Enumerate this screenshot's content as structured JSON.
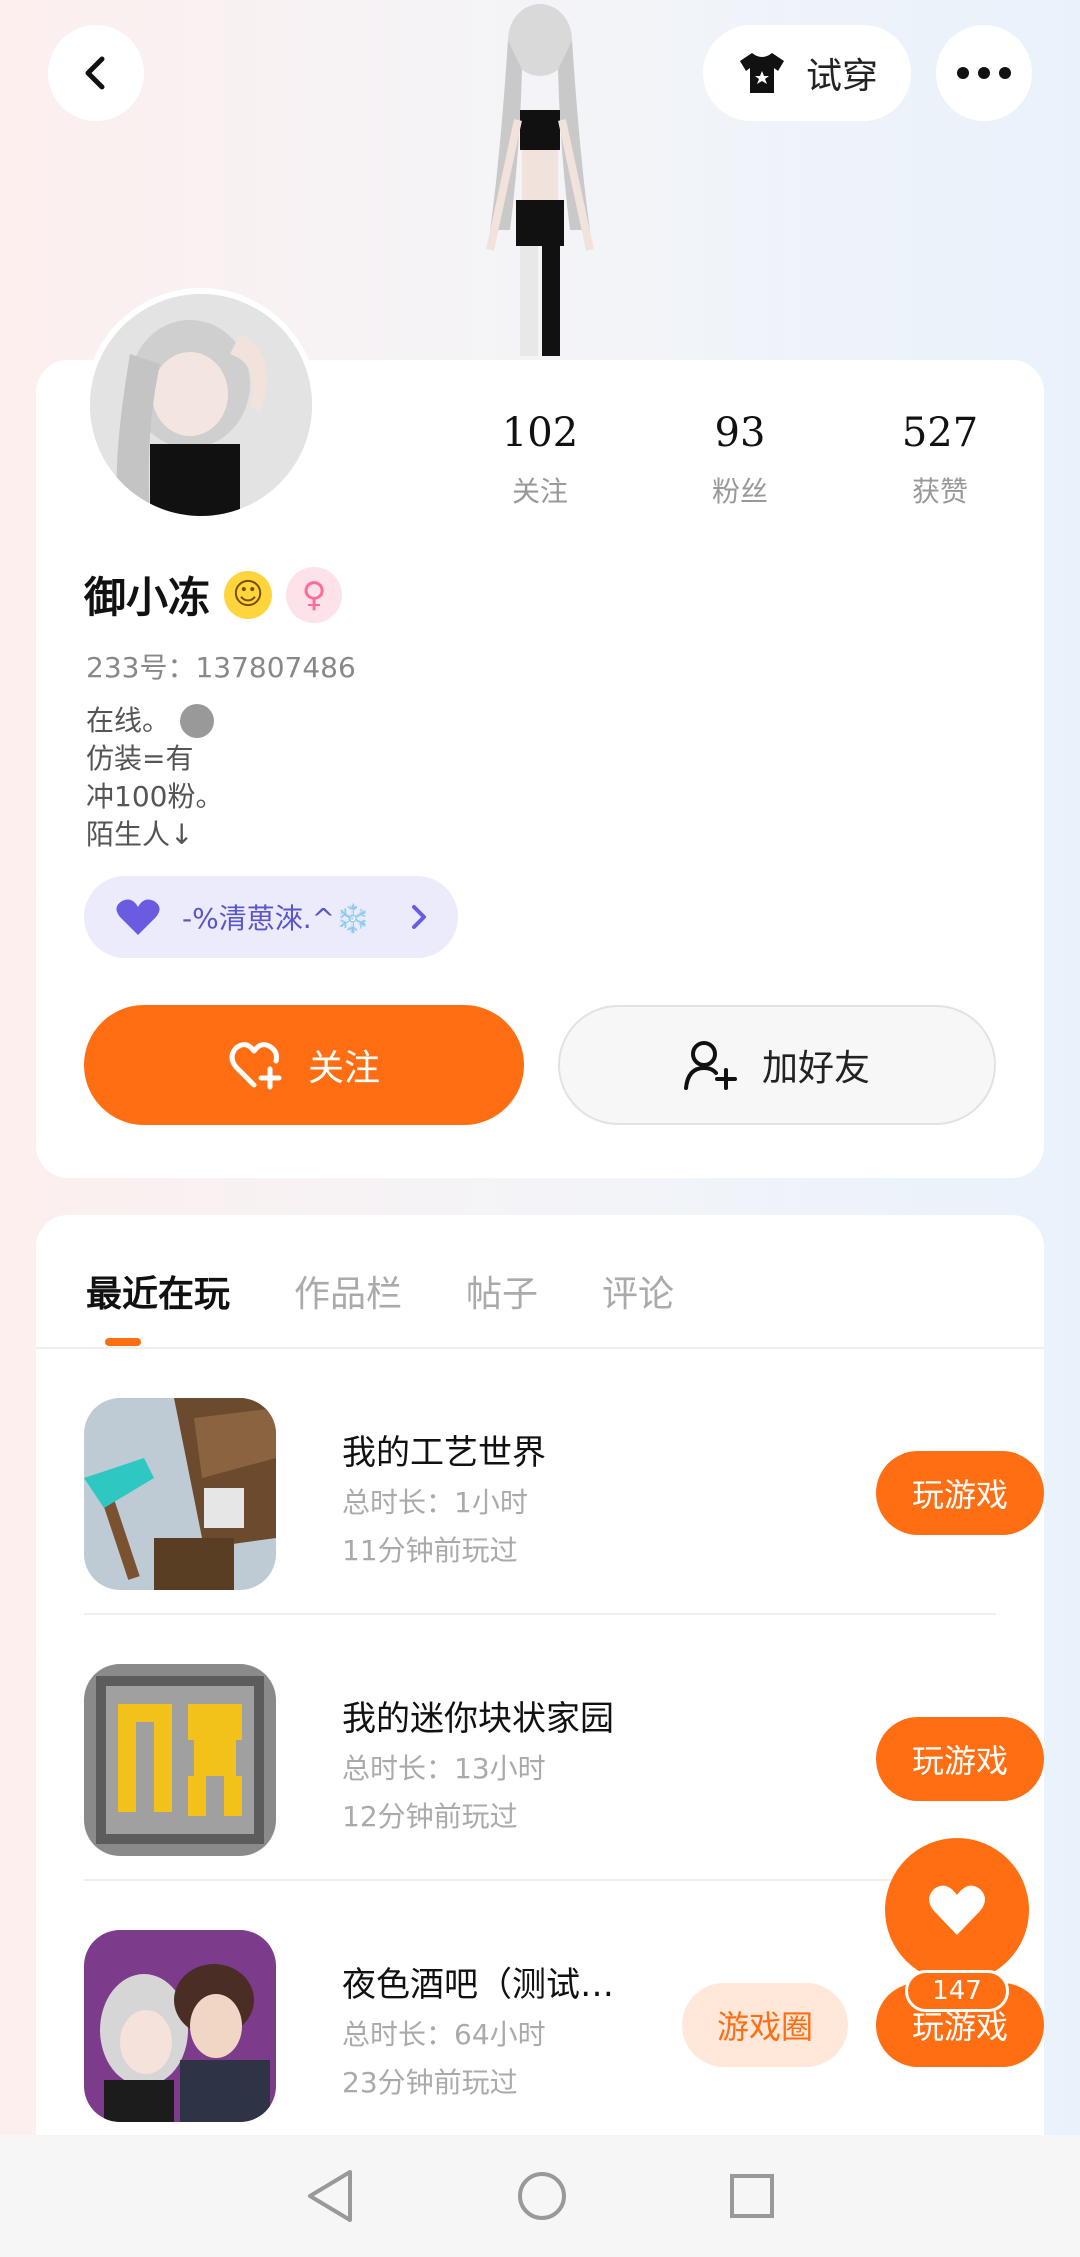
{
  "header": {
    "tryon_label": "试穿"
  },
  "profile": {
    "nickname": "御小冻",
    "user_id": "233号：137807486",
    "gender_symbol": "♀",
    "bio": [
      "在线。",
      "仿装=有",
      "冲100粉。",
      "陌生人↓"
    ],
    "tag": "-%清葸淶.^❄️",
    "stats": [
      {
        "value": "102",
        "label": "关注"
      },
      {
        "value": "93",
        "label": "粉丝"
      },
      {
        "value": "527",
        "label": "获赞"
      }
    ],
    "follow_label": "关注",
    "add_friend_label": "加好友"
  },
  "tabs": [
    {
      "label": "最近在玩",
      "active": true
    },
    {
      "label": "作品栏",
      "active": false
    },
    {
      "label": "帖子",
      "active": false
    },
    {
      "label": "评论",
      "active": false
    }
  ],
  "games": [
    {
      "title": "我的工艺世界",
      "total": "总时长：1小时",
      "last": "11分钟前玩过",
      "play_label": "玩游戏"
    },
    {
      "title": "我的迷你块状家园",
      "total": "总时长：13小时",
      "last": "12分钟前玩过",
      "play_label": "玩游戏"
    },
    {
      "title": "夜色酒吧（测试…",
      "total": "总时长：64小时",
      "last": "23分钟前玩过",
      "play_label": "玩游戏",
      "circle_label": "游戏圈"
    }
  ],
  "like_count": "147",
  "colors": {
    "accent": "#ff6e12",
    "tag_bg": "#ecebfb",
    "tag_text": "#5a55c8"
  }
}
